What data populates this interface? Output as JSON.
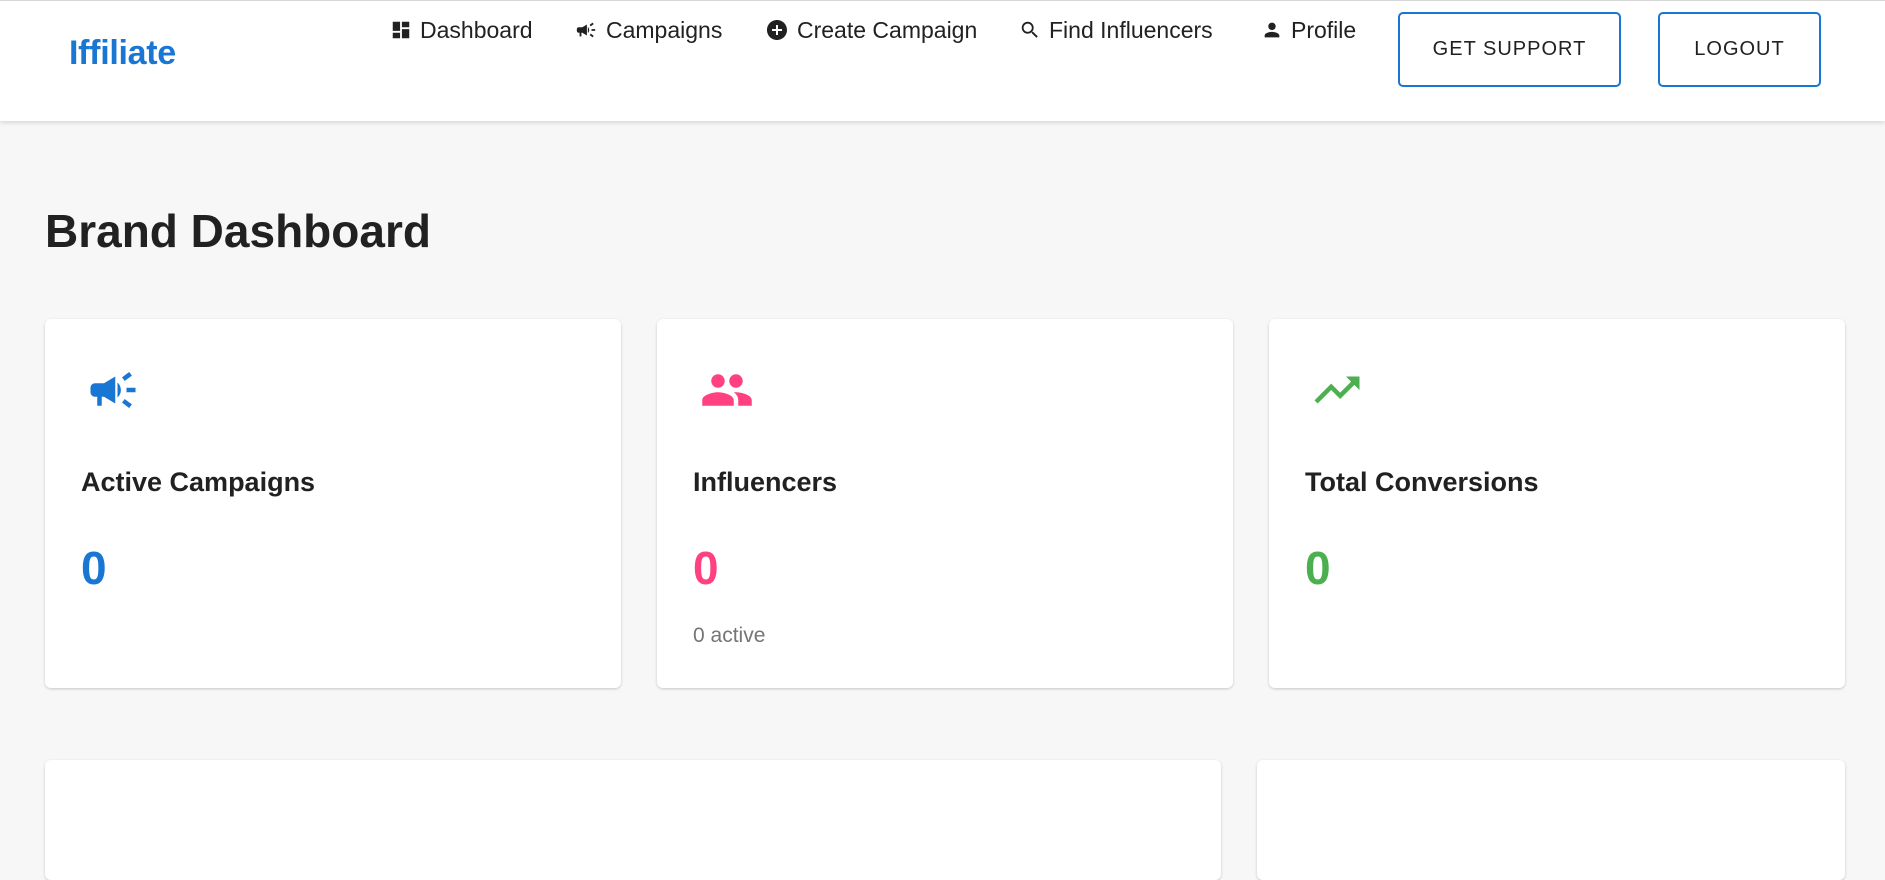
{
  "app": {
    "brand": "Iffiliate",
    "brand_color": "#1976d2"
  },
  "nav": {
    "items": [
      {
        "label": "Dashboard",
        "icon": "dashboard-icon"
      },
      {
        "label": "Campaigns",
        "icon": "campaign-icon"
      },
      {
        "label": "Create Campaign",
        "icon": "add-circle-icon"
      },
      {
        "label": "Find Influencers",
        "icon": "search-icon"
      },
      {
        "label": "Profile",
        "icon": "person-icon"
      }
    ],
    "support_label": "GET SUPPORT",
    "logout_label": "LOGOUT"
  },
  "page": {
    "title": "Brand Dashboard"
  },
  "stats": [
    {
      "label": "Active Campaigns",
      "value": "0",
      "icon": "campaign-icon",
      "color": "#1976d2"
    },
    {
      "label": "Influencers",
      "value": "0",
      "sub": "0 active",
      "icon": "people-icon",
      "color": "#ff4081"
    },
    {
      "label": "Total Conversions",
      "value": "0",
      "icon": "trending-up-icon",
      "color": "#4caf50"
    }
  ]
}
